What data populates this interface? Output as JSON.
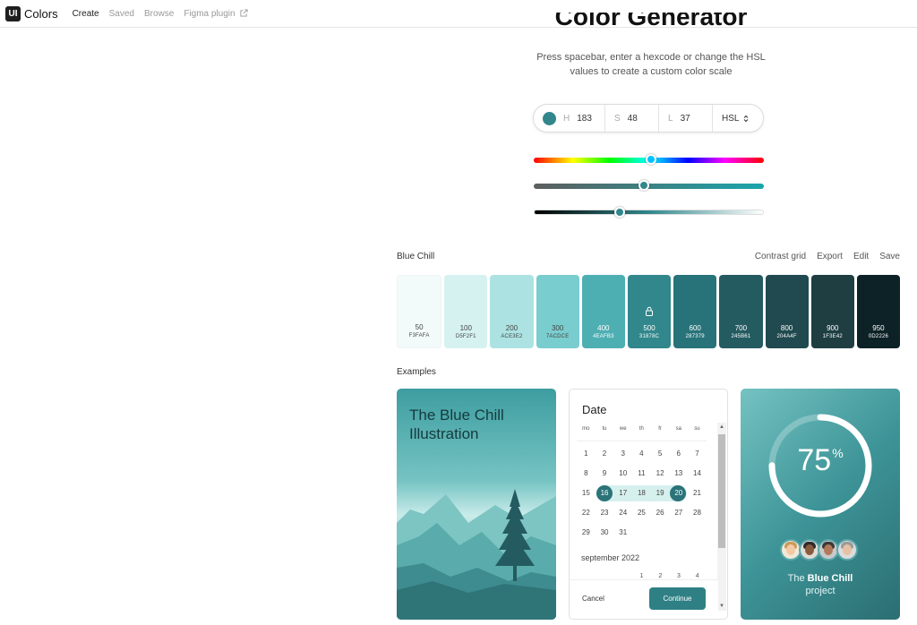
{
  "nav": {
    "logo_badge": "UI",
    "logo_text": "Colors",
    "links": [
      "Create",
      "Saved",
      "Browse",
      "Figma plugin"
    ]
  },
  "header": {
    "title": "Color Generator",
    "subtitle": "Press spacebar, enter a hexcode or change the HSL values to create a custom color scale"
  },
  "hsl": {
    "h_label": "H",
    "h_value": "183",
    "s_label": "S",
    "s_value": "48",
    "l_label": "L",
    "l_value": "37",
    "mode": "HSL",
    "swatch_color": "#31878c"
  },
  "sliders": {
    "hue": 183,
    "saturation": 48,
    "lightness": 37
  },
  "palette": {
    "name": "Blue Chill",
    "actions": [
      "Contrast grid",
      "Export",
      "Edit",
      "Save"
    ],
    "shades": [
      {
        "step": "50",
        "hex": "F3FAFA",
        "color": "#f3fafa",
        "text": "#444444"
      },
      {
        "step": "100",
        "hex": "D5F2F1",
        "color": "#d5f2f1",
        "text": "#444444"
      },
      {
        "step": "200",
        "hex": "ACE3E2",
        "color": "#ace3e2",
        "text": "#444444"
      },
      {
        "step": "300",
        "hex": "7ACDCE",
        "color": "#7acdce",
        "text": "#444444"
      },
      {
        "step": "400",
        "hex": "4EAFB3",
        "color": "#4eafb3",
        "text": "#ffffff"
      },
      {
        "step": "500",
        "hex": "31878C",
        "color": "#31878c",
        "text": "#ffffff",
        "locked": true
      },
      {
        "step": "600",
        "hex": "287379",
        "color": "#287379",
        "text": "#ffffff"
      },
      {
        "step": "700",
        "hex": "245B61",
        "color": "#245b61",
        "text": "#ffffff"
      },
      {
        "step": "800",
        "hex": "204A4F",
        "color": "#204a4f",
        "text": "#ffffff"
      },
      {
        "step": "900",
        "hex": "1F3E42",
        "color": "#1f3e42",
        "text": "#ffffff"
      },
      {
        "step": "950",
        "hex": "0D2226",
        "color": "#0d2226",
        "text": "#ffffff"
      }
    ]
  },
  "examples": {
    "label": "Examples",
    "illustration_title": "The Blue Chill Illustration",
    "calendar": {
      "title": "Date",
      "weekdays": [
        "mo",
        "tu",
        "we",
        "th",
        "fr",
        "sa",
        "su"
      ],
      "weeks": [
        [
          "1",
          "2",
          "3",
          "4",
          "5",
          "6",
          "7"
        ],
        [
          "8",
          "9",
          "10",
          "11",
          "12",
          "13",
          "14"
        ],
        [
          "15",
          "16",
          "17",
          "18",
          "19",
          "20",
          "21"
        ],
        [
          "22",
          "23",
          "24",
          "25",
          "26",
          "27",
          "28"
        ],
        [
          "29",
          "30",
          "31",
          "",
          "",
          "",
          ""
        ]
      ],
      "selected_start": "16",
      "selected_end": "20",
      "next_month": "september 2022",
      "next_month_first_row": [
        "1",
        "2",
        "3",
        "4"
      ],
      "cancel": "Cancel",
      "continue": "Continue"
    },
    "progress": {
      "value": "75",
      "unit": "%",
      "project_prefix": "The",
      "project_name": "Blue Chill",
      "project_suffix": "project"
    }
  },
  "colors": {
    "accent": "#31878c",
    "dark": "#2b7378"
  }
}
